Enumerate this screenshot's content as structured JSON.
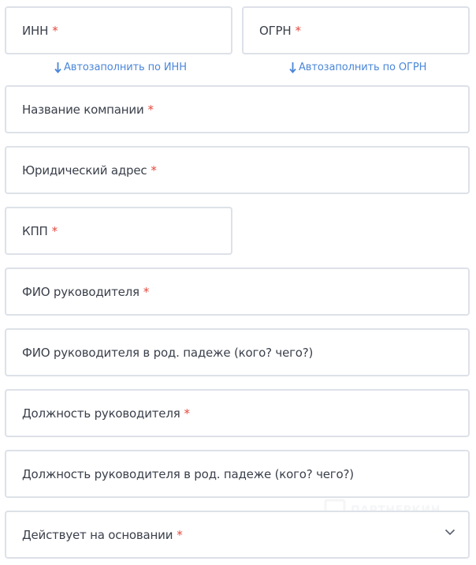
{
  "fields": {
    "inn": {
      "label": "ИНН",
      "required": "*"
    },
    "ogrn": {
      "label": "ОГРН",
      "required": "*"
    },
    "company_name": {
      "label": "Название компании",
      "required": "*"
    },
    "legal_address": {
      "label": "Юридический адрес",
      "required": "*"
    },
    "kpp": {
      "label": "КПП",
      "required": "*"
    },
    "director_name": {
      "label": "ФИО руководителя",
      "required": "*"
    },
    "director_name_genitive": {
      "label": "ФИО руководителя в род. падеже (кого? чего?)"
    },
    "director_position": {
      "label": "Должность руководителя",
      "required": "*"
    },
    "director_position_genitive": {
      "label": "Должность руководителя в род. падеже (кого? чего?)"
    },
    "basis": {
      "label": "Действует на основании",
      "required": "*",
      "icon": "chevron-down-icon"
    }
  },
  "autofill": {
    "inn": {
      "label": "Автозаполнить по ИНН",
      "icon": "arrow-down-icon"
    },
    "ogrn": {
      "label": "Автозаполнить по ОГРН",
      "icon": "arrow-down-icon"
    }
  },
  "watermark": {
    "text": "ПАРТНЕРКИН"
  },
  "colors": {
    "required": "#e5483d",
    "link": "#4a86d8",
    "border": "#dde1e8",
    "text": "#3a3f4a"
  }
}
